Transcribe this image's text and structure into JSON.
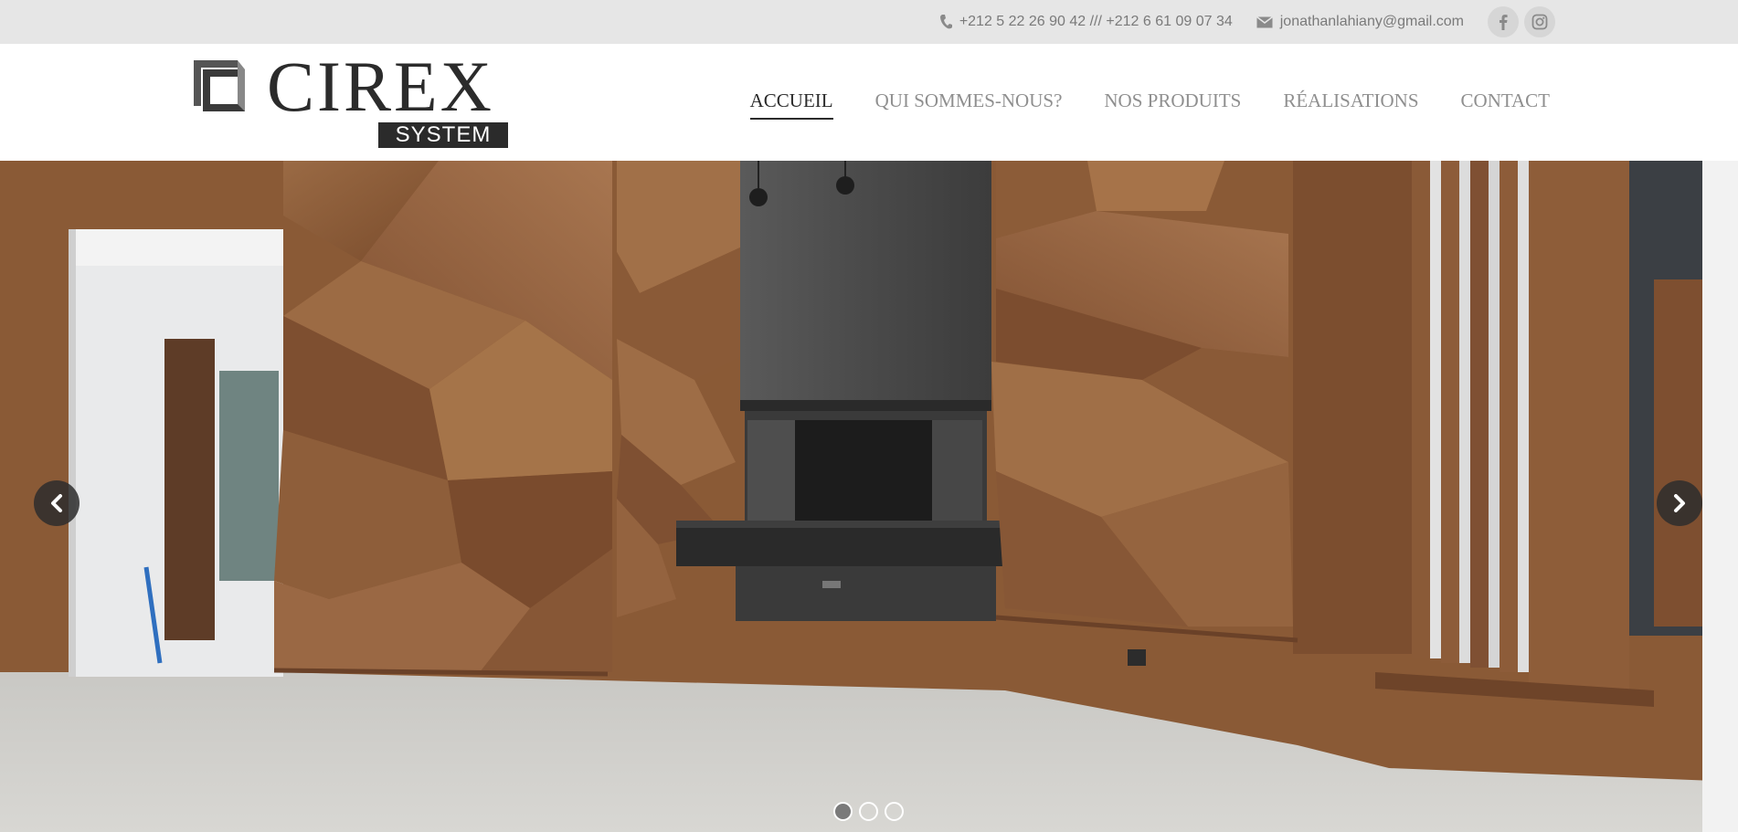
{
  "topbar": {
    "phone": "+212 5 22 26 90 42 /// +212 6 61 09 07 34",
    "email": "jonathanlahiany@gmail.com",
    "socials": [
      "facebook-icon",
      "instagram-icon"
    ]
  },
  "logo": {
    "word": "CIREX",
    "sub": "SYSTEM"
  },
  "nav": {
    "items": [
      {
        "label": "ACCUEIL",
        "active": true
      },
      {
        "label": "QUI SOMMES-NOUS?",
        "active": false
      },
      {
        "label": "NOS PRODUITS",
        "active": false
      },
      {
        "label": "RÉALISATIONS",
        "active": false
      },
      {
        "label": "CONTACT",
        "active": false
      }
    ]
  },
  "slider": {
    "slide_count": 3,
    "active_slide": 1,
    "prev_icon": "chevron-left-icon",
    "next_icon": "chevron-right-icon"
  },
  "colors": {
    "topbar_bg": "#e6e6e6",
    "text_muted": "#8f8f8f",
    "text_dark": "#2b2b2b",
    "wood": "#8a5a36"
  }
}
